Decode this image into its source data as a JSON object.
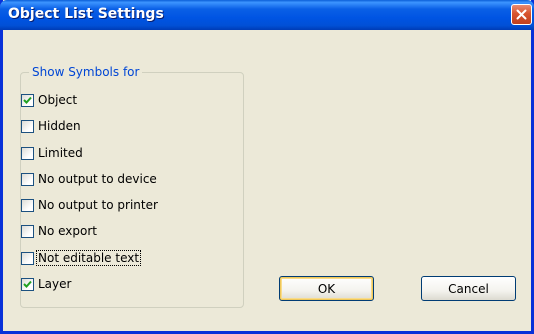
{
  "window": {
    "title": "Object List Settings"
  },
  "group": {
    "label": "Show Symbols for",
    "items": [
      {
        "label": "Object",
        "checked": true
      },
      {
        "label": "Hidden",
        "checked": false
      },
      {
        "label": "Limited",
        "checked": false
      },
      {
        "label": "No output to device",
        "checked": false
      },
      {
        "label": "No output to printer",
        "checked": false
      },
      {
        "label": "No export",
        "checked": false
      },
      {
        "label": "Not editable text",
        "checked": false,
        "focused": true
      },
      {
        "label": "Layer",
        "checked": true
      }
    ]
  },
  "buttons": {
    "ok": "OK",
    "cancel": "Cancel"
  },
  "icons": {
    "close": "close-icon",
    "check": "checkmark-icon"
  },
  "colors": {
    "title_bar": "#0054e3",
    "group_label": "#0046d5",
    "checkmark": "#21a121",
    "close_button": "#d8542e"
  }
}
